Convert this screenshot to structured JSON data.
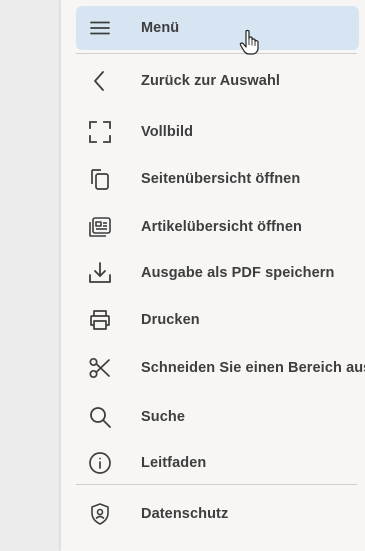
{
  "menu": {
    "header": {
      "label": "Menü",
      "icon": "hamburger-menu-icon"
    },
    "items": [
      {
        "label": "Zurück zur Auswahl",
        "icon": "chevron-left-icon"
      },
      {
        "label": "Vollbild",
        "icon": "fullscreen-icon"
      },
      {
        "label": "Seitenübersicht öffnen",
        "icon": "copy-pages-icon"
      },
      {
        "label": "Artikelübersicht öffnen",
        "icon": "article-overview-icon"
      },
      {
        "label": "Ausgabe als PDF speichern",
        "icon": "download-icon"
      },
      {
        "label": "Drucken",
        "icon": "printer-icon"
      },
      {
        "label": "Schneiden Sie einen Bereich aus",
        "icon": "scissors-icon"
      },
      {
        "label": "Suche",
        "icon": "search-icon"
      },
      {
        "label": "Leitfaden",
        "icon": "info-icon"
      }
    ],
    "footer": {
      "label": "Datenschutz",
      "icon": "privacy-shield-icon"
    }
  },
  "colors": {
    "active_background": "#d6e5f1",
    "panel_background": "#f7f6f4",
    "text": "#3e3e3e"
  }
}
